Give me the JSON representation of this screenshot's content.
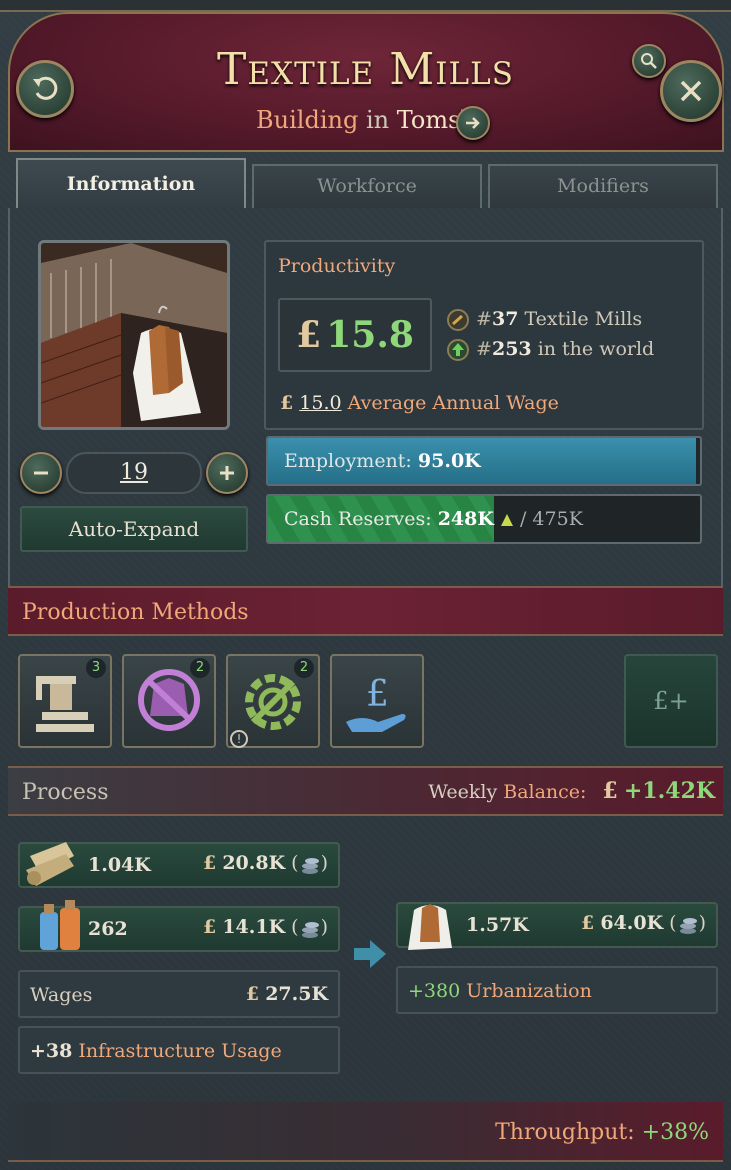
{
  "header": {
    "title": "Textile Mills",
    "subtitle_building": "Building",
    "subtitle_in": "in",
    "subtitle_location": "Tomsk"
  },
  "tabs": [
    {
      "label": "Information"
    },
    {
      "label": "Workforce"
    },
    {
      "label": "Modifiers"
    }
  ],
  "info": {
    "productivity_label": "Productivity",
    "currency": "£",
    "productivity_value": "15.8",
    "rank1_prefix": "#",
    "rank1_num": "37",
    "rank1_text": "Textile Mills",
    "rank2_prefix": "#",
    "rank2_num": "253",
    "rank2_text": "in the world",
    "wage_value": "15.0",
    "wage_label": "Average Annual Wage",
    "level": "19",
    "auto_expand": "Auto-Expand",
    "employment_label": "Employment:",
    "employment_value": "95.0K",
    "employment_fill": 0.99,
    "cash_label": "Cash Reserves:",
    "cash_value": "248K",
    "cash_max": "/ 475K",
    "cash_fill": 0.522
  },
  "pm": {
    "title": "Production Methods",
    "badges": [
      "3",
      "2",
      "2"
    ],
    "add_label": "£+"
  },
  "process": {
    "title": "Process",
    "weekly": "Weekly",
    "balance": "Balance:",
    "balance_value": "+1.42K",
    "inputs": [
      {
        "qty": "1.04K",
        "price": "20.8K"
      },
      {
        "qty": "262",
        "price": "14.1K"
      }
    ],
    "wages_label": "Wages",
    "wages_value": "27.5K",
    "infra_value": "+38",
    "infra_label": "Infrastructure Usage",
    "output": {
      "qty": "1.57K",
      "price": "64.0K"
    },
    "urban_value": "+380",
    "urban_label": "Urbanization",
    "throughput_label": "Throughput:",
    "throughput_value": "+38%"
  },
  "colors": {
    "accent_orange": "#f0a87a",
    "positive_green": "#8fd87a",
    "header_red": "#6b2234",
    "employment_blue": "#2f7f99",
    "cash_green": "#2e8a4a"
  }
}
